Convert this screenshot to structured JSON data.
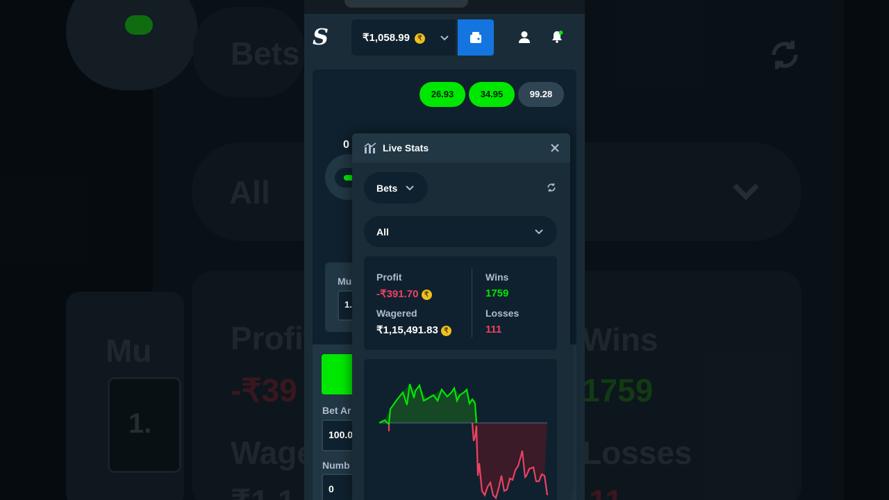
{
  "header": {
    "logo": "S",
    "balance": "₹1,058.99",
    "coin_symbol": "₹"
  },
  "background": {
    "bets": "Bets",
    "all": "All",
    "profit": "Profit",
    "profit_value": "-₹39",
    "wagered": "Wage",
    "wagered_value": "₹1,1",
    "wins": "Wins",
    "wins_value": "1759",
    "losses": "Losses",
    "losses_value": "11",
    "mu": "Mu",
    "mult": "1."
  },
  "game": {
    "recent_multipliers": [
      "26.93",
      "34.95",
      "99.28"
    ],
    "counter": "0",
    "mu_label": "Mu",
    "mult_field": "1.",
    "bet_amount_label": "Bet Ar",
    "bet_amount_value": "100.0",
    "number_label": "Numb",
    "number_value": "0"
  },
  "live_stats": {
    "title": "Live Stats",
    "type_dropdown": "Bets",
    "range_dropdown": "All",
    "profit_label": "Profit",
    "profit_value": "-₹391.70",
    "wagered_label": "Wagered",
    "wagered_value": "₹1,15,491.83",
    "wins_label": "Wins",
    "wins_value": "1759",
    "losses_label": "Losses",
    "losses_value": "111"
  },
  "colors": {
    "accent_green": "#00e701",
    "loss_red": "#ed4163",
    "wallet_blue": "#1475e1",
    "coin_gold": "#f0c020"
  },
  "icons": [
    "wallet-icon",
    "user-icon",
    "bell-icon",
    "chart-icon",
    "close-icon",
    "chevron-down-icon",
    "refresh-icon"
  ]
}
